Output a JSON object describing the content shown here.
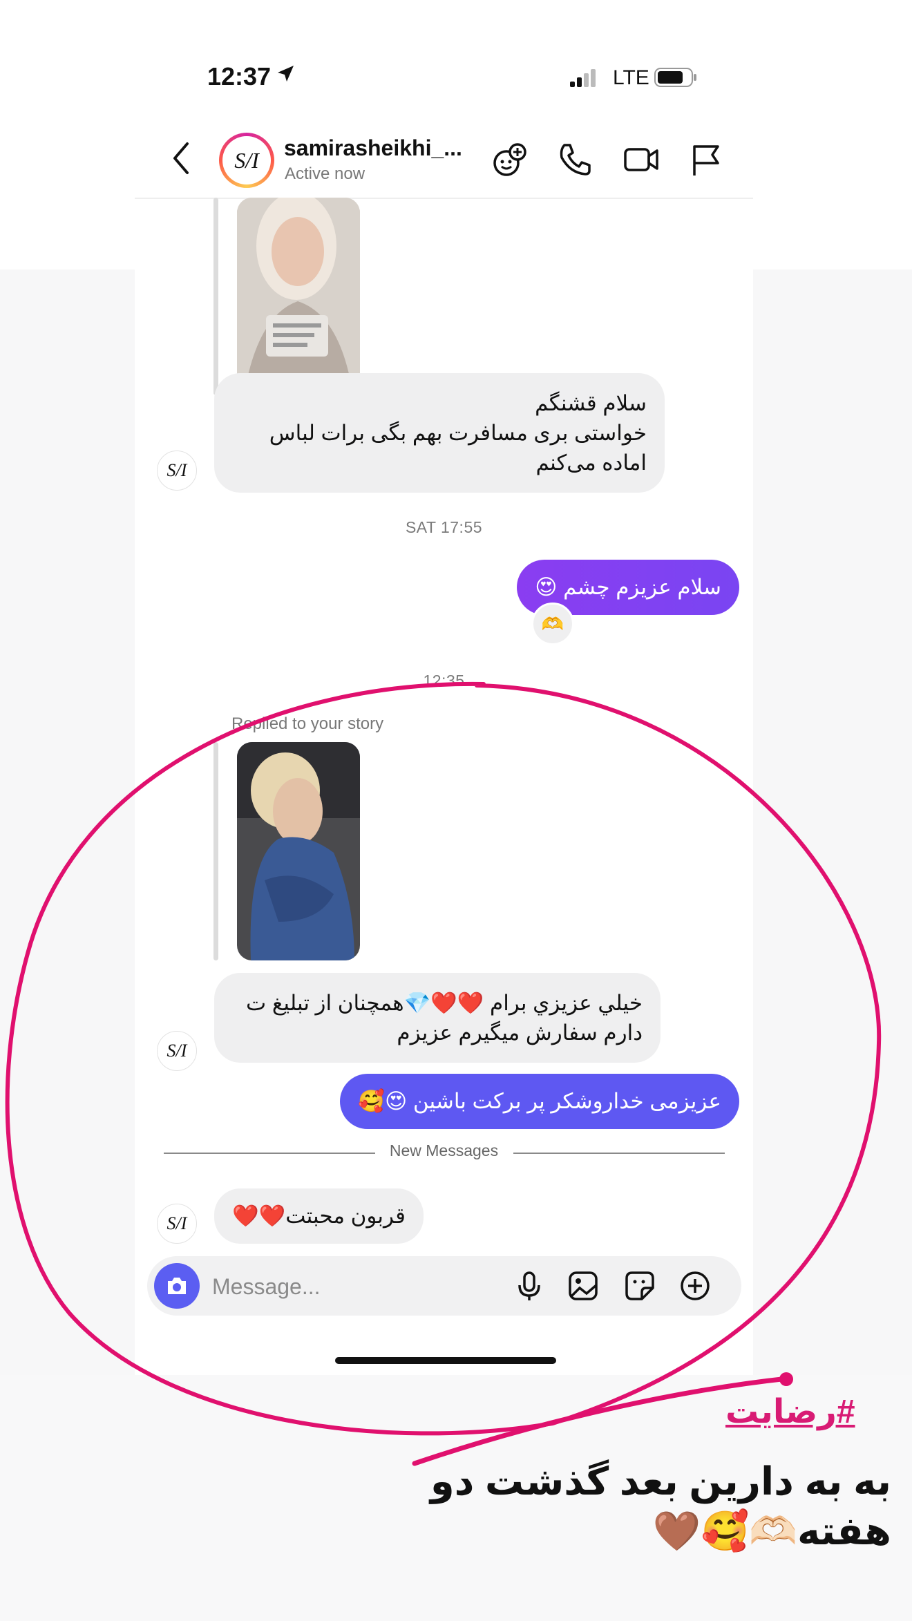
{
  "status_bar": {
    "time": "12:37",
    "network": "LTE"
  },
  "header": {
    "avatar_initials": "S/I",
    "name": "samirasheikhi_...",
    "status": "Active now"
  },
  "thread": {
    "msg_hello": "سلام قشنگم\nخواستی بری مسافرت بهم بگی برات لباس اماده می‌کنم",
    "timestamp_1": "SAT 17:55",
    "msg_out_1": "سلام عزیزم چشم 😍",
    "reaction_1": "🫶",
    "timestamp_2": "12:35",
    "replied_label": "Replied to your story",
    "msg_story_reply": "خيلي عزيزي برام ❤️❤️💎همچنان از تبليغ ت دارم سفارش میگیرم عزیزم",
    "msg_out_2": "عزیزمی خداروشکر  پر برکت باشین 😍🥰",
    "new_messages": "New Messages",
    "msg_last": "قربون محبتت❤️❤️"
  },
  "composer": {
    "placeholder": "Message..."
  },
  "overlay": {
    "hashtag": "#رضایت",
    "caption": "به به دارین بعد گذشت دو هفته🫶🏻🥰🤎"
  },
  "colors": {
    "accent": "#6b4cf0",
    "ink": "#e0106e",
    "bubble_in": "#efeff0"
  }
}
